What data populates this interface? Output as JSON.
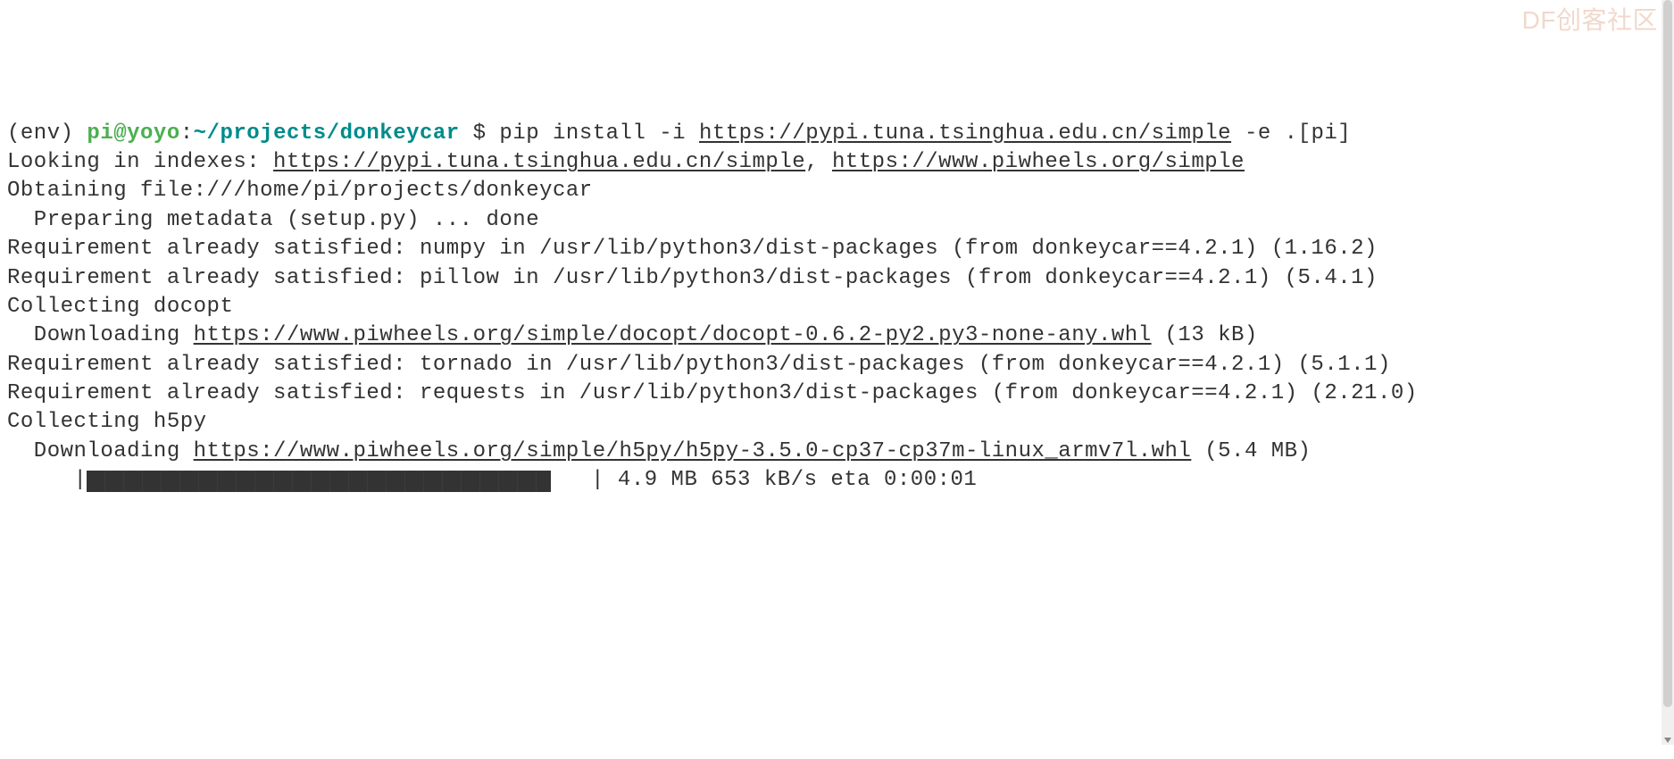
{
  "prompt": {
    "env": "(env) ",
    "user": "pi@yoyo",
    "sep1": ":",
    "cwd": "~/projects/donkeycar",
    "sep2": " $ ",
    "cmd_before_link": "pip install -i ",
    "cmd_link": "https://pypi.tuna.tsinghua.edu.cn/simple",
    "cmd_after_link": " -e .[pi]"
  },
  "indexes": {
    "prefix": "Looking in indexes: ",
    "link1": "https://pypi.tuna.tsinghua.edu.cn/simple",
    "sep": ", ",
    "link2": "https://www.piwheels.org/simple"
  },
  "obtaining": "Obtaining file:///home/pi/projects/donkeycar",
  "preparing": "  Preparing metadata (setup.py) ... done",
  "req_numpy": "Requirement already satisfied: numpy in /usr/lib/python3/dist-packages (from donkeycar==4.2.1) (1.16.2)",
  "req_pillow": "Requirement already satisfied: pillow in /usr/lib/python3/dist-packages (from donkeycar==4.2.1) (5.4.1)",
  "collect_docopt": "Collecting docopt",
  "download_docopt": {
    "prefix": "  Downloading ",
    "link": "https://www.piwheels.org/simple/docopt/docopt-0.6.2-py2.py3-none-any.whl",
    "suffix": " (13 kB)"
  },
  "req_tornado": "Requirement already satisfied: tornado in /usr/lib/python3/dist-packages (from donkeycar==4.2.1) (5.1.1)",
  "req_requests": "Requirement already satisfied: requests in /usr/lib/python3/dist-packages (from donkeycar==4.2.1) (2.21.0)",
  "collect_h5py": "Collecting h5py",
  "download_h5py": {
    "prefix": "  Downloading ",
    "link": "https://www.piwheels.org/simple/h5py/h5py-3.5.0-cp37-cp37m-linux_armv7l.whl",
    "suffix": " (5.4 MB)"
  },
  "progress": {
    "prefix": "     |",
    "text_after": "   | 4.9 MB 653 kB/s eta 0:00:01"
  },
  "watermark": "DF创客社区"
}
